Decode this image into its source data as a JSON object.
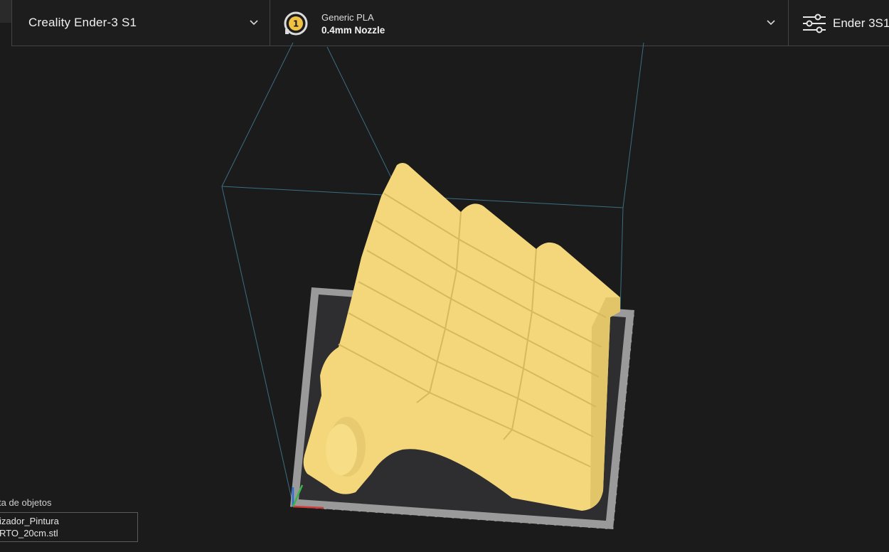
{
  "header": {
    "printer": {
      "name": "Creality Ender-3 S1",
      "icon": "chevron-down-icon"
    },
    "material": {
      "extruder_number": "1",
      "material_name": "Generic PLA",
      "nozzle": "0.4mm Nozzle",
      "icon": "chevron-down-icon"
    },
    "settings": {
      "profile": "Ender 3S1",
      "icon": "sliders-icon"
    }
  },
  "viewport": {
    "model_color": "#f4d77b",
    "build_volume_color": "#3b6f80",
    "bed_border_color": "#9a9a9a",
    "bed_color": "#2e2e30"
  },
  "object_list": {
    "title": "ta de objetos",
    "item_lines": [
      "izador_Pintura",
      "RTO_20cm.stl"
    ]
  },
  "colors": {
    "background": "#1b1b1c",
    "panel_border": "#434345",
    "badge_yellow": "#f0c244"
  }
}
